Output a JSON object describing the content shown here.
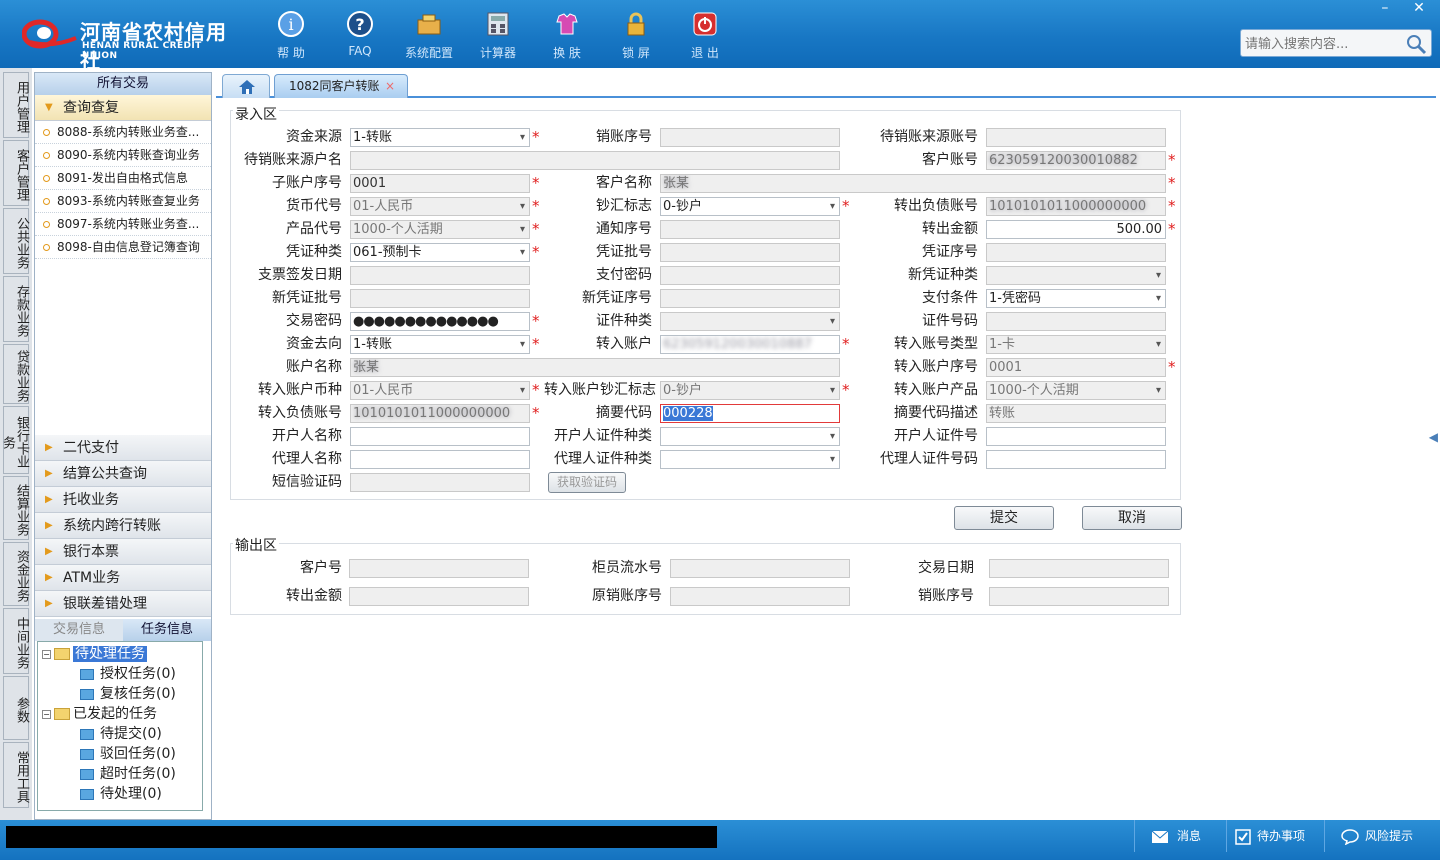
{
  "app": {
    "logo_cn": "河南省农村信用社",
    "logo_en": "HENAN RURAL CREDIT UNION",
    "toolbar": [
      {
        "label": "帮 助",
        "icon": "help-icon"
      },
      {
        "label": "FAQ",
        "icon": "faq-icon"
      },
      {
        "label": "系统配置",
        "icon": "config-icon"
      },
      {
        "label": "计算器",
        "icon": "calculator-icon"
      },
      {
        "label": "换 肤",
        "icon": "skin-icon"
      },
      {
        "label": "锁 屏",
        "icon": "lock-icon"
      },
      {
        "label": "退 出",
        "icon": "power-icon"
      }
    ],
    "window": {
      "minimize": "–",
      "close": "✕"
    },
    "search": {
      "placeholder": "请输入搜索内容..."
    }
  },
  "vtabs": [
    "用户管理",
    "客户管理",
    "公共业务",
    "存款业务",
    "贷款业务",
    "银行卡业务",
    "结算业务",
    "资金业务",
    "中间业务",
    "参数",
    "常用工具"
  ],
  "sidebar": {
    "header": "所有交易",
    "open_category": "查询查复",
    "items": [
      "8088-系统内转账业务查...",
      "8090-系统内转账查询业务",
      "8091-发出自由格式信息",
      "8093-系统内转账查复业务",
      "8097-系统内转账业务查...",
      "8098-自由信息登记簿查询"
    ],
    "categories": [
      "二代支付",
      "结算公共查询",
      "托收业务",
      "系统内跨行转账",
      "银行本票",
      "ATM业务",
      "银联差错处理"
    ],
    "task_tabs": [
      "交易信息",
      "任务信息"
    ],
    "tree": {
      "pending": "待处理任务",
      "auth": "授权任务(0)",
      "review": "复核任务(0)",
      "initiated": "已发起的任务",
      "to_submit": "待提交(0)",
      "rejected": "驳回任务(0)",
      "timeout": "超时任务(0)",
      "to_process": "待处理(0)"
    }
  },
  "tabs": {
    "active": "1082同客户转账",
    "close": "×"
  },
  "entry": {
    "legend": "录入区",
    "fields": {
      "fund_source": {
        "label": "资金来源",
        "value": "1-转账"
      },
      "cancel_seq": {
        "label": "销账序号",
        "value": ""
      },
      "pending_src_acct": {
        "label": "待销账来源账号",
        "value": ""
      },
      "pending_src_name": {
        "label": "待销账来源户名",
        "value": ""
      },
      "customer_acct": {
        "label": "客户账号",
        "value": "623059120030010882"
      },
      "sub_acct_seq": {
        "label": "子账户序号",
        "value": "0001"
      },
      "customer_name": {
        "label": "客户名称",
        "value": "张某"
      },
      "currency": {
        "label": "货币代号",
        "value": "01-人民币"
      },
      "cash_flag": {
        "label": "钞汇标志",
        "value": "0-钞户"
      },
      "out_debt_acct": {
        "label": "转出负债账号",
        "value": "1010101011000000000"
      },
      "product_code": {
        "label": "产品代号",
        "value": "1000-个人活期"
      },
      "notice_seq": {
        "label": "通知序号",
        "value": ""
      },
      "out_amount": {
        "label": "转出金额",
        "value": "500.00"
      },
      "voucher_type": {
        "label": "凭证种类",
        "value": "061-预制卡"
      },
      "voucher_batch": {
        "label": "凭证批号",
        "value": ""
      },
      "voucher_seq": {
        "label": "凭证序号",
        "value": ""
      },
      "check_date": {
        "label": "支票签发日期",
        "value": ""
      },
      "pay_pwd": {
        "label": "支付密码",
        "value": ""
      },
      "new_voucher_type": {
        "label": "新凭证种类",
        "value": ""
      },
      "new_voucher_batch": {
        "label": "新凭证批号",
        "value": ""
      },
      "new_voucher_seq": {
        "label": "新凭证序号",
        "value": ""
      },
      "pay_cond": {
        "label": "支付条件",
        "value": "1-凭密码"
      },
      "trade_pwd": {
        "label": "交易密码",
        "value": "●●●●●●●●●●●●●●"
      },
      "id_type": {
        "label": "证件种类",
        "value": ""
      },
      "id_no": {
        "label": "证件号码",
        "value": ""
      },
      "fund_dest": {
        "label": "资金去向",
        "value": "1-转账"
      },
      "in_acct": {
        "label": "转入账户",
        "value": "623059120030010887"
      },
      "in_acct_type": {
        "label": "转入账号类型",
        "value": "1-卡"
      },
      "acct_name": {
        "label": "账户名称",
        "value": "张某"
      },
      "in_acct_seq": {
        "label": "转入账户序号",
        "value": "0001"
      },
      "in_currency": {
        "label": "转入账户币种",
        "value": "01-人民币"
      },
      "in_cash_flag": {
        "label": "转入账户钞汇标志",
        "value": "0-钞户"
      },
      "in_product": {
        "label": "转入账户产品",
        "value": "1000-个人活期"
      },
      "in_debt_acct": {
        "label": "转入负债账号",
        "value": "1010101011000000000"
      },
      "summary_code": {
        "label": "摘要代码",
        "value": "000228"
      },
      "summary_desc": {
        "label": "摘要代码描述",
        "value": "转账"
      },
      "opener_name": {
        "label": "开户人名称",
        "value": ""
      },
      "opener_id_type": {
        "label": "开户人证件种类",
        "value": ""
      },
      "opener_id_no": {
        "label": "开户人证件号",
        "value": ""
      },
      "agent_name": {
        "label": "代理人名称",
        "value": ""
      },
      "agent_id_type": {
        "label": "代理人证件种类",
        "value": ""
      },
      "agent_id_no": {
        "label": "代理人证件号码",
        "value": ""
      },
      "sms_code": {
        "label": "短信验证码",
        "value": ""
      }
    },
    "get_code_btn": "获取验证码",
    "required_mark": "*"
  },
  "actions": {
    "submit": "提交",
    "cancel": "取消"
  },
  "output": {
    "legend": "输出区",
    "customer_no": {
      "label": "客户号",
      "value": ""
    },
    "teller_seq": {
      "label": "柜员流水号",
      "value": ""
    },
    "trade_date": {
      "label": "交易日期",
      "value": ""
    },
    "out_amount": {
      "label": "转出金额",
      "value": ""
    },
    "orig_cancel_seq": {
      "label": "原销账序号",
      "value": ""
    },
    "cancel_seq": {
      "label": "销账序号",
      "value": ""
    }
  },
  "statusbar": {
    "message": "消息",
    "todo": "待办事项",
    "risk": "风险提示"
  }
}
